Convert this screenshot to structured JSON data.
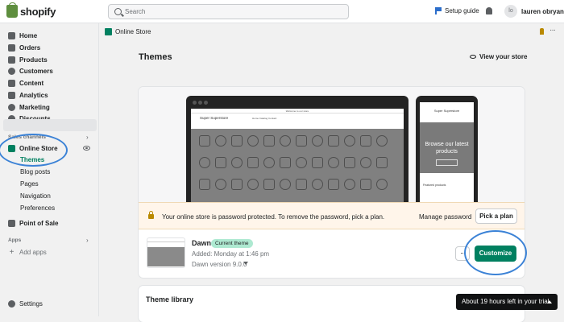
{
  "topbar": {
    "logo": "shopify",
    "search_placeholder": "Search",
    "setup_guide": "Setup guide",
    "avatar_initials": "lo",
    "username": "lauren obryan"
  },
  "sidebar": {
    "items": [
      {
        "label": "Home",
        "icon": "home-icon"
      },
      {
        "label": "Orders",
        "icon": "orders-icon"
      },
      {
        "label": "Products",
        "icon": "tag-icon"
      },
      {
        "label": "Customers",
        "icon": "person-icon"
      },
      {
        "label": "Content",
        "icon": "content-icon"
      },
      {
        "label": "Analytics",
        "icon": "analytics-icon"
      },
      {
        "label": "Marketing",
        "icon": "marketing-icon"
      },
      {
        "label": "Discounts",
        "icon": "discount-icon"
      }
    ],
    "sales_channels_label": "Sales channels",
    "online_store": "Online Store",
    "sub_items": [
      "Themes",
      "Blog posts",
      "Pages",
      "Navigation",
      "Preferences"
    ],
    "point_of_sale": "Point of Sale",
    "apps_label": "Apps",
    "add_apps": "Add apps",
    "settings": "Settings"
  },
  "pagebar": {
    "title": "Online Store"
  },
  "main": {
    "title": "Themes",
    "view_store": "View your store",
    "preview": {
      "laptop_announcement": "Welcome to our store",
      "laptop_store": "Super Superstore",
      "laptop_links": "Home   Catalog   Contact",
      "phone_store": "Super Superstore",
      "phone_hero": "Browse our latest products",
      "phone_featured": "Featured products"
    },
    "banner": {
      "text": "Your online store is password protected. To remove the password, pick a plan.",
      "manage_password": "Manage password",
      "pick_plan": "Pick a plan"
    },
    "theme": {
      "name": "Dawn",
      "badge": "Current theme",
      "added": "Added: Monday at 1:46 pm",
      "version": "Dawn version 9.0.0",
      "dots": "···",
      "customize": "Customize"
    },
    "library_title": "Theme library"
  },
  "trial": "About 19 hours left in your trial",
  "colors": {
    "accent": "#008060",
    "highlight_circle": "#3b82d6",
    "banner_bg": "#fff5ea",
    "trial_bg": "#111213"
  }
}
